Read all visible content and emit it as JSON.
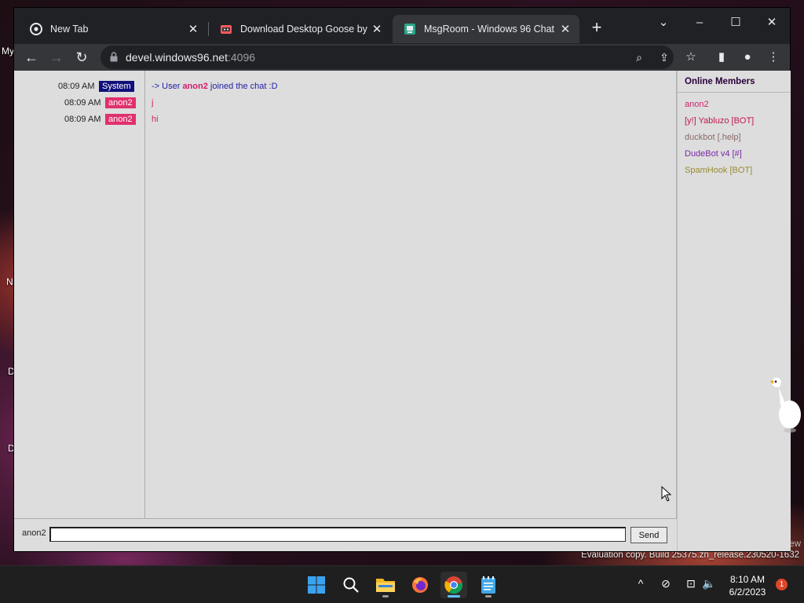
{
  "desktop": {
    "labels": [
      "My",
      "N",
      "D",
      "D"
    ],
    "eval_text": "Evaluation copy. Build 25375.zn_release.230520-1632",
    "eval_tail": "ew"
  },
  "browser": {
    "tabs": [
      {
        "title": "New Tab",
        "icon": "chrome-icon",
        "active": false
      },
      {
        "title": "Download Desktop Goose by sam",
        "icon": "itch-store-icon",
        "active": false
      },
      {
        "title": "MsgRoom - Windows 96 Chat",
        "icon": "msgroom-icon",
        "active": true
      }
    ],
    "url": {
      "host": "devel.windows96.net",
      "port": ":4096"
    },
    "new_tab_glyph": "+",
    "window_controls": {
      "dropdown": "⌄",
      "minimize": "–",
      "maximize": "☐",
      "close": "✕"
    },
    "nav": {
      "back": "←",
      "forward": "→",
      "reload": "↻"
    },
    "omnibox_icons": {
      "zoom": "⌕",
      "share": "⇪",
      "bookmark": "☆"
    },
    "toolbar_icons": {
      "sidebar": "▮",
      "profile": "●",
      "menu": "⋮"
    }
  },
  "chat": {
    "messages": [
      {
        "time": "08:09 AM",
        "user": "System",
        "badge_color": "#10107a",
        "text_parts": [
          {
            "t": "-> User ",
            "c": "#2222aa",
            "b": false
          },
          {
            "t": "anon2",
            "c": "#d0206a",
            "b": true
          },
          {
            "t": " joined the chat :D",
            "c": "#2222aa",
            "b": false
          }
        ]
      },
      {
        "time": "08:09 AM",
        "user": "anon2",
        "badge_color": "#e0306e",
        "text_parts": [
          {
            "t": "j",
            "c": "#d0206a",
            "b": false
          }
        ]
      },
      {
        "time": "08:09 AM",
        "user": "anon2",
        "badge_color": "#e0306e",
        "text_parts": [
          {
            "t": "hi",
            "c": "#d0206a",
            "b": false
          }
        ]
      }
    ],
    "members_title": "Online Members",
    "members": [
      {
        "name": "anon2",
        "color": "#d0206a"
      },
      {
        "name": "[y!] Yabluzo [BOT]",
        "color": "#c0184a"
      },
      {
        "name": "duckbot [.help]",
        "color": "#8a6a6a"
      },
      {
        "name": "DudeBot v4 [#]",
        "color": "#7a28a8"
      },
      {
        "name": "SpamHook [BOT]",
        "color": "#9a8a30"
      }
    ],
    "input": {
      "username": "anon2",
      "value": "",
      "placeholder": ""
    },
    "send_label": "Send"
  },
  "taskbar": {
    "apps": [
      {
        "name": "start-button",
        "active": false,
        "indicator": false
      },
      {
        "name": "search-button",
        "active": false,
        "indicator": false
      },
      {
        "name": "file-explorer",
        "active": false,
        "indicator": true
      },
      {
        "name": "firefox",
        "active": false,
        "indicator": false
      },
      {
        "name": "chrome",
        "active": true,
        "indicator": true
      },
      {
        "name": "notepad",
        "active": false,
        "indicator": true
      }
    ],
    "tray": {
      "chevron": "^",
      "network": "⊘",
      "display": "⊡",
      "volume": "🔈"
    },
    "time": "8:10 AM",
    "date": "6/2/2023",
    "notification_count": "1"
  }
}
